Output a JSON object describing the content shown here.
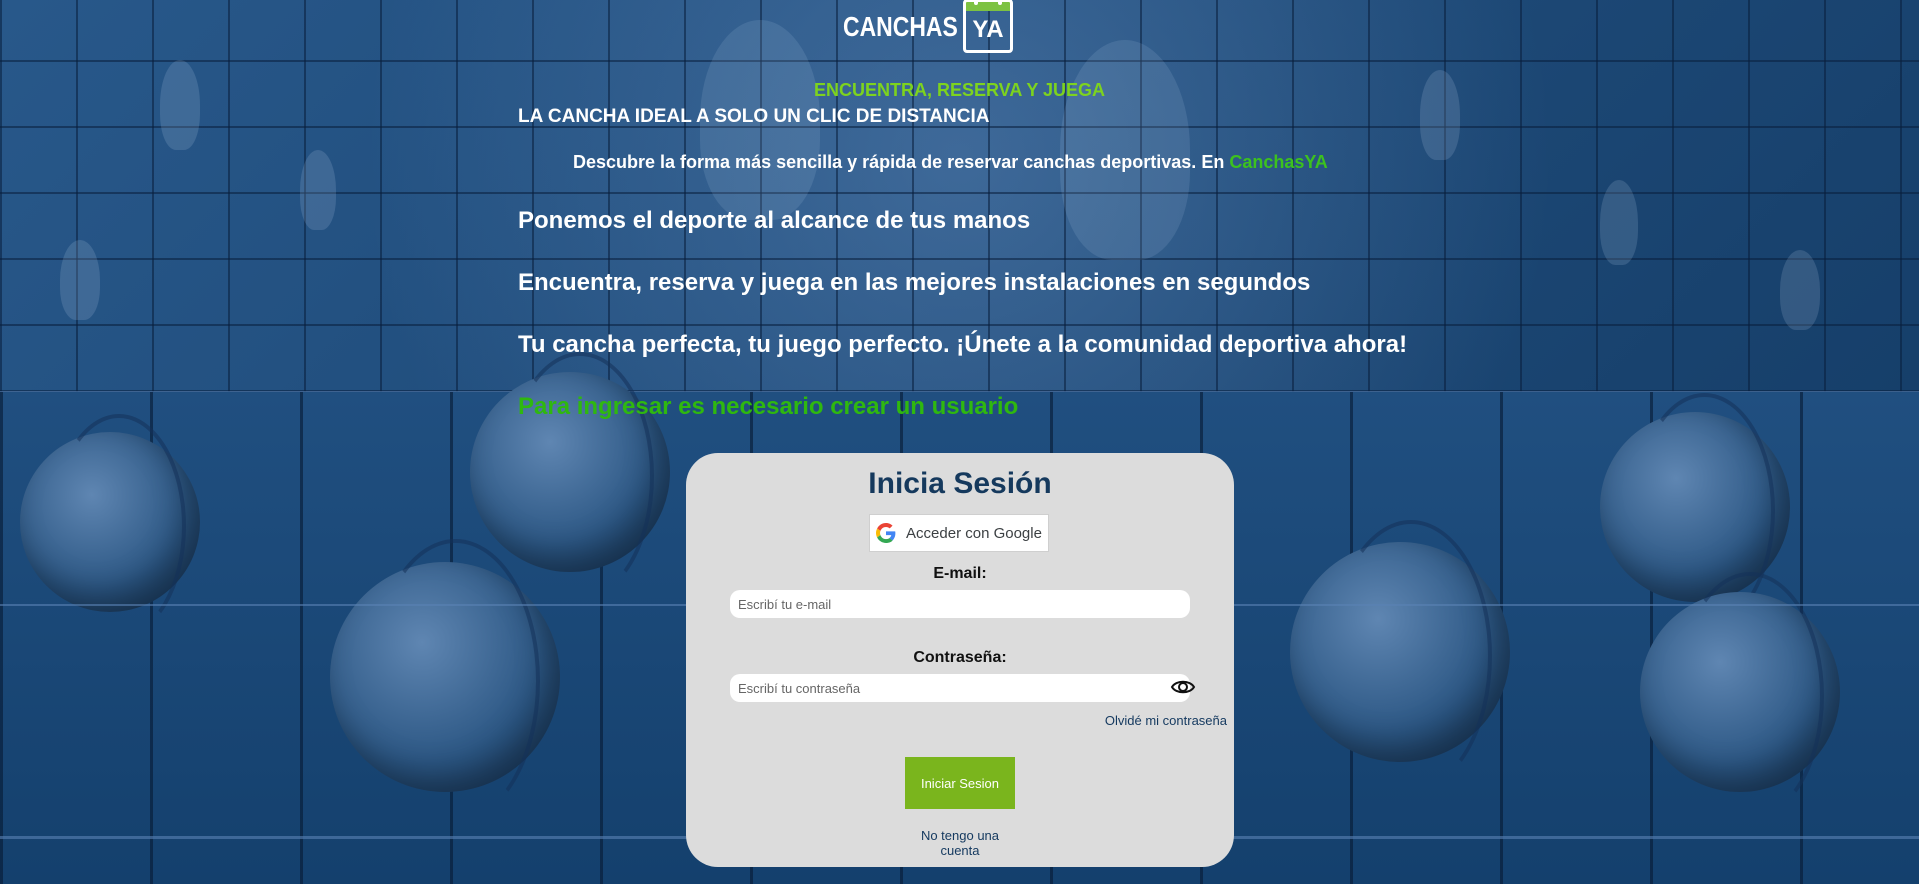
{
  "header": {
    "logo_text": "CANCHAS",
    "logo_badge": "YA",
    "tagline_green": "ENCUENTRA, RESERVA Y JUEGA",
    "tagline_white": "LA CANCHA IDEAL A SOLO UN CLIC DE DISTANCIA"
  },
  "intro": {
    "text": "Descubre la forma más sencilla y rápida de reservar canchas deportivas. En ",
    "brand": "CanchasYA"
  },
  "lines": {
    "line1": "Ponemos el deporte al alcance de tus manos",
    "line2": "Encuentra, reserva y juega en las mejores instalaciones en segundos",
    "line3": "Tu cancha perfecta, tu juego perfecto. ¡Únete a la comunidad deportiva ahora!",
    "line4": "Para ingresar es necesario crear un usuario"
  },
  "login": {
    "title": "Inicia Sesión",
    "google_label": "Acceder con Google",
    "email_label": "E-mail:",
    "email_placeholder": "Escribí tu e-mail",
    "password_label": "Contraseña:",
    "password_placeholder": "Escribí tu contraseña",
    "forgot": "Olvidé mi contraseña",
    "submit": "Iniciar Sesion",
    "no_account": "No tengo una cuenta"
  },
  "colors": {
    "accent_green": "#7ab51d",
    "brand_green": "#3cc21e",
    "title_navy": "#15395d"
  },
  "icons": [
    "google-icon",
    "eye-icon",
    "calendar-icon"
  ]
}
